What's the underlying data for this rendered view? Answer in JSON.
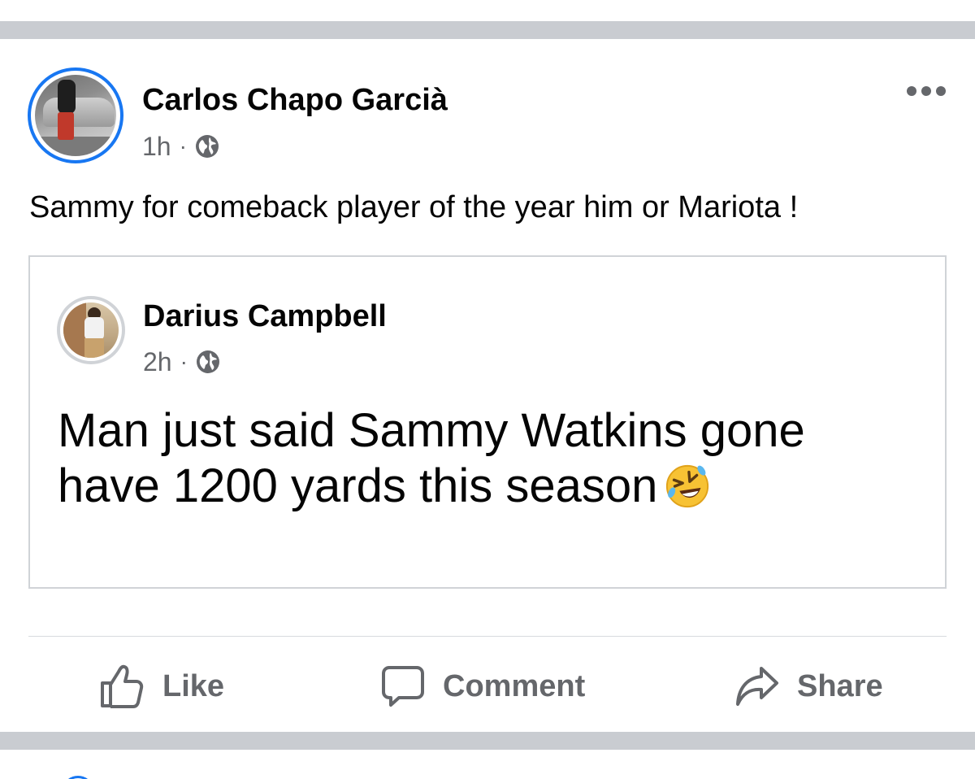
{
  "post": {
    "author": "Carlos Chapo Garcià",
    "time": "1h",
    "separator": "·",
    "privacy_icon": "globe-icon",
    "text": "Sammy for comeback player of the year him or Mariota !",
    "more_icon": "more-options-icon"
  },
  "shared_post": {
    "author": "Darius Campbell",
    "time": "2h",
    "separator": "·",
    "privacy_icon": "globe-icon",
    "text_line1": "Man just said Sammy Watkins gone",
    "text_line2": "have 1200 yards this season",
    "emoji": "rolling-on-floor-laughing-emoji"
  },
  "actions": {
    "like_label": "Like",
    "comment_label": "Comment",
    "share_label": "Share"
  },
  "colors": {
    "accent": "#1877f2",
    "secondary_text": "#65676b",
    "divider": "#c9ccd1"
  }
}
